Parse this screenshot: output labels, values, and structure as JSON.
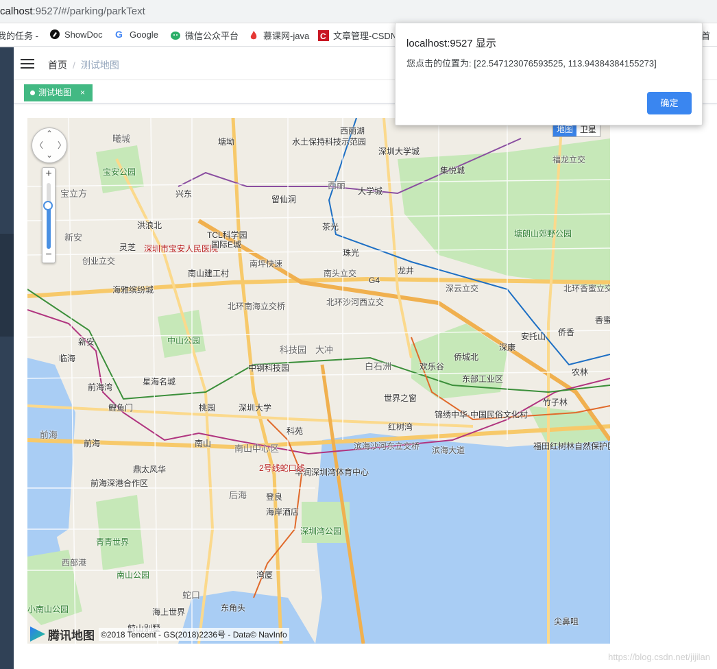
{
  "browser": {
    "url_host": "calhost",
    "url_rest": ":9527/#/parking/parkText"
  },
  "bookmarks": [
    {
      "label": "我的任务 -",
      "icon": "task-icon"
    },
    {
      "label": "ShowDoc",
      "icon": "showdoc-icon"
    },
    {
      "label": "Google",
      "icon": "google-icon"
    },
    {
      "label": "微信公众平台",
      "icon": "wechat-icon"
    },
    {
      "label": "慕课网-java",
      "icon": "flame-icon"
    },
    {
      "label": "文章管理-CSDN",
      "icon": "csdn-icon"
    },
    {
      "label": "首",
      "icon": ""
    }
  ],
  "navbar": {
    "breadcrumb_home": "首页",
    "breadcrumb_separator": "/",
    "breadcrumb_current": "测试地图"
  },
  "tags": {
    "active_tag": "测试地图",
    "close_glyph": "×"
  },
  "map": {
    "maptype_map": "地图",
    "maptype_satellite": "卫星",
    "zoom_in": "+",
    "zoom_out": "−",
    "brand": "腾讯地图",
    "copyright": "©2018 Tencent - GS(2018)2236号 - Data© NavInfo",
    "labels": [
      {
        "text": "曦城",
        "cls": "district"
      },
      {
        "text": "宝安公园",
        "cls": "park"
      },
      {
        "text": "宝立方",
        "cls": "district"
      },
      {
        "text": "兴东",
        "cls": ""
      },
      {
        "text": "洪浪北",
        "cls": ""
      },
      {
        "text": "新安",
        "cls": "district"
      },
      {
        "text": "灵芝",
        "cls": ""
      },
      {
        "text": "深圳市宝安人民医院",
        "cls": "poi"
      },
      {
        "text": "创业立交",
        "cls": "road"
      },
      {
        "text": "海雅缤纷城",
        "cls": ""
      },
      {
        "text": "TCL科学园",
        "cls": ""
      },
      {
        "text": "国际E城",
        "cls": ""
      },
      {
        "text": "南山建工村",
        "cls": ""
      },
      {
        "text": "塘坳",
        "cls": ""
      },
      {
        "text": "水土保持科技示范园",
        "cls": ""
      },
      {
        "text": "留仙洞",
        "cls": ""
      },
      {
        "text": "西丽湖",
        "cls": ""
      },
      {
        "text": "深圳大学城",
        "cls": ""
      },
      {
        "text": "西丽",
        "cls": "district"
      },
      {
        "text": "大学城",
        "cls": ""
      },
      {
        "text": "茶光",
        "cls": ""
      },
      {
        "text": "集悦城",
        "cls": ""
      },
      {
        "text": "福龙立交",
        "cls": "road"
      },
      {
        "text": "塘朗山郊野公园",
        "cls": "park"
      },
      {
        "text": "珠光",
        "cls": ""
      },
      {
        "text": "龙井",
        "cls": ""
      },
      {
        "text": "南坪快速",
        "cls": "road"
      },
      {
        "text": "南头立交",
        "cls": "road"
      },
      {
        "text": "深云立交",
        "cls": "road"
      },
      {
        "text": "北环香蜜立交",
        "cls": "road"
      },
      {
        "text": "北环南海立交桥",
        "cls": "road"
      },
      {
        "text": "北环沙河西立交",
        "cls": "road"
      },
      {
        "text": "安托山",
        "cls": ""
      },
      {
        "text": "侨香",
        "cls": ""
      },
      {
        "text": "香蜜",
        "cls": ""
      },
      {
        "text": "新安",
        "cls": ""
      },
      {
        "text": "临海",
        "cls": ""
      },
      {
        "text": "中山公园",
        "cls": "park"
      },
      {
        "text": "科技园",
        "cls": "district"
      },
      {
        "text": "大冲",
        "cls": "district"
      },
      {
        "text": "深康",
        "cls": ""
      },
      {
        "text": "侨城北",
        "cls": ""
      },
      {
        "text": "欢乐谷",
        "cls": ""
      },
      {
        "text": "东部工业区",
        "cls": ""
      },
      {
        "text": "中钢科技园",
        "cls": ""
      },
      {
        "text": "白石洲",
        "cls": "district"
      },
      {
        "text": "农林",
        "cls": ""
      },
      {
        "text": "前海湾",
        "cls": ""
      },
      {
        "text": "星海名城",
        "cls": ""
      },
      {
        "text": "鲤鱼门",
        "cls": ""
      },
      {
        "text": "桃园",
        "cls": ""
      },
      {
        "text": "深圳大学",
        "cls": ""
      },
      {
        "text": "世界之窗",
        "cls": ""
      },
      {
        "text": "锦绣中华·中国民俗文化村",
        "cls": ""
      },
      {
        "text": "竹子林",
        "cls": ""
      },
      {
        "text": "前海",
        "cls": "district"
      },
      {
        "text": "前海",
        "cls": ""
      },
      {
        "text": "南山",
        "cls": ""
      },
      {
        "text": "南山中心区",
        "cls": "district"
      },
      {
        "text": "科苑",
        "cls": ""
      },
      {
        "text": "红树湾",
        "cls": ""
      },
      {
        "text": "滨海沙河东立交桥",
        "cls": "road"
      },
      {
        "text": "滨海大道",
        "cls": "road"
      },
      {
        "text": "福田红树林自然保护区",
        "cls": ""
      },
      {
        "text": "鼎太风华",
        "cls": ""
      },
      {
        "text": "前海深港合作区",
        "cls": ""
      },
      {
        "text": "华润深圳湾体育中心",
        "cls": ""
      },
      {
        "text": "后海",
        "cls": "district"
      },
      {
        "text": "登良",
        "cls": ""
      },
      {
        "text": "海岸酒店",
        "cls": ""
      },
      {
        "text": "深圳湾公园",
        "cls": "park"
      },
      {
        "text": "青青世界",
        "cls": "park"
      },
      {
        "text": "西部港",
        "cls": "road"
      },
      {
        "text": "南山公园",
        "cls": "park"
      },
      {
        "text": "湾厦",
        "cls": ""
      },
      {
        "text": "蛇口",
        "cls": "district"
      },
      {
        "text": "东角头",
        "cls": ""
      },
      {
        "text": "海上世界",
        "cls": ""
      },
      {
        "text": "小南山公园",
        "cls": "park"
      },
      {
        "text": "鲸山别墅",
        "cls": ""
      },
      {
        "text": "尖鼻咀",
        "cls": ""
      },
      {
        "text": "2号线蛇口线",
        "cls": "poi"
      },
      {
        "text": "G4",
        "cls": ""
      }
    ]
  },
  "dialog": {
    "title": "localhost:9527 显示",
    "message": "您点击的位置为: [22.547123076593525, 113.94384384155273]",
    "ok_label": "确定"
  },
  "watermark": "https://blog.csdn.net/jijilan"
}
